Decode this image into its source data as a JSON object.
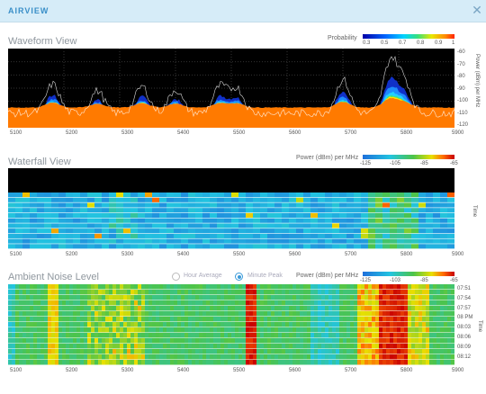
{
  "dialog": {
    "title": "AIRVIEW",
    "close_icon": "close-icon"
  },
  "waveform": {
    "title": "Waveform View",
    "legend_label": "Probability",
    "legend_ticks": [
      "0.3",
      "0.5",
      "0.7",
      "0.8",
      "0.9",
      "1"
    ],
    "y_ticks": [
      "-60",
      "-70",
      "-80",
      "-90",
      "-100",
      "-110",
      "-120"
    ],
    "y_axis_label": "Power (dBm) per MHz"
  },
  "waterfall": {
    "title": "Waterfall View",
    "legend_label": "Power (dBm) per MHz",
    "legend_ticks": [
      "-125",
      "-105",
      "-85",
      "-65"
    ],
    "y_axis_label": "Time"
  },
  "ambient": {
    "title": "Ambient Noise Level",
    "option_hour": "Hour Average",
    "option_minute": "Minute Peak",
    "selected": "Minute Peak",
    "legend_label": "Power (dBm) per MHz",
    "legend_ticks": [
      "-125",
      "-103",
      "-85",
      "-65"
    ],
    "time_ticks": [
      "07:51",
      "07:54",
      "07:57",
      "08 PM",
      "08:03",
      "08:06",
      "08:09",
      "08:12"
    ],
    "y_axis_label": "Time"
  },
  "x_ticks": [
    "5100",
    "5200",
    "5300",
    "5400",
    "5500",
    "5600",
    "5700",
    "5800",
    "5900"
  ],
  "colors": {
    "accent": "#3a8fc8",
    "titlebar": "#d6ecf8"
  },
  "chart_data": [
    {
      "type": "area",
      "title": "Waveform View",
      "xlim": [
        5100,
        5900
      ],
      "ylim": [
        -120,
        -60
      ],
      "ylabel": "Power (dBm) per MHz",
      "legend": "Probability",
      "peaks": [
        {
          "x": 5180,
          "y": -94
        },
        {
          "x": 5260,
          "y": -100
        },
        {
          "x": 5340,
          "y": -96
        },
        {
          "x": 5400,
          "y": -99
        },
        {
          "x": 5480,
          "y": -96
        },
        {
          "x": 5510,
          "y": -98
        },
        {
          "x": 5700,
          "y": -90
        },
        {
          "x": 5785,
          "y": -74
        },
        {
          "x": 5810,
          "y": -92
        }
      ]
    },
    {
      "type": "heatmap",
      "title": "Waterfall View",
      "xlim": [
        5100,
        5900
      ],
      "legend": "Power (dBm) per MHz",
      "color_range": [
        -125,
        -65
      ]
    },
    {
      "type": "heatmap",
      "title": "Ambient Noise Level",
      "xlim": [
        5100,
        5900
      ],
      "legend": "Power (dBm) per MHz",
      "color_range": [
        -125,
        -65
      ],
      "time_ticks": [
        "07:51",
        "07:54",
        "07:57",
        "08 PM",
        "08:03",
        "08:06",
        "08:09",
        "08:12"
      ]
    }
  ]
}
